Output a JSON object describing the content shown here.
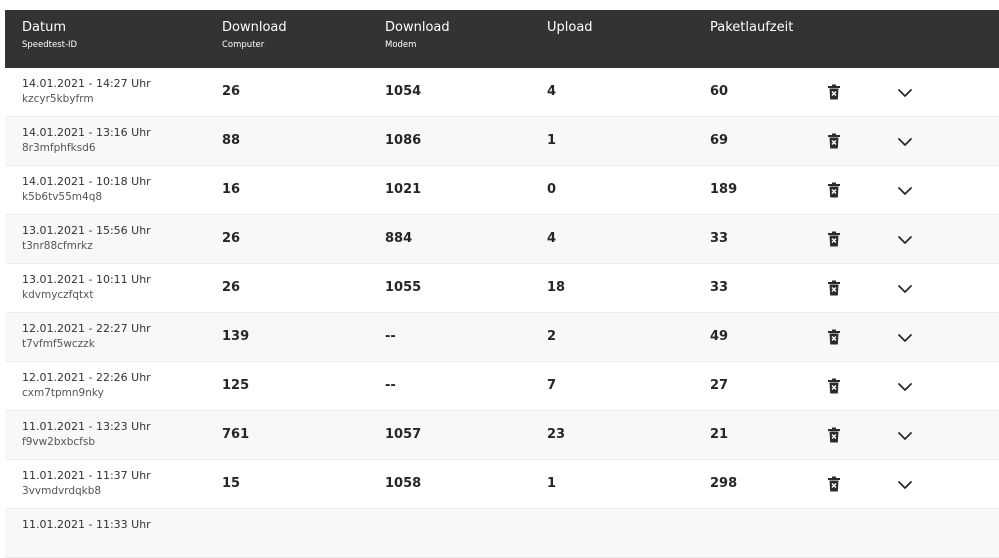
{
  "header": {
    "col_datum": "Datum",
    "col_datum_sub": "Speedtest-ID",
    "col_dl_computer": "Download",
    "col_dl_computer_sub": "Computer",
    "col_dl_modem": "Download",
    "col_dl_modem_sub": "Modem",
    "col_upload": "Upload",
    "col_ping": "Paketlaufzeit"
  },
  "rows": [
    {
      "date": "14.01.2021 - 14:27 Uhr",
      "id": "kzcyr5kbyfrm",
      "dl_computer": "26",
      "dl_modem": "1054",
      "upload": "4",
      "ping": "60"
    },
    {
      "date": "14.01.2021 - 13:16 Uhr",
      "id": "8r3mfphfksd6",
      "dl_computer": "88",
      "dl_modem": "1086",
      "upload": "1",
      "ping": "69"
    },
    {
      "date": "14.01.2021 - 10:18 Uhr",
      "id": "k5b6tv55m4q8",
      "dl_computer": "16",
      "dl_modem": "1021",
      "upload": "0",
      "ping": "189"
    },
    {
      "date": "13.01.2021 - 15:56 Uhr",
      "id": "t3nr88cfmrkz",
      "dl_computer": "26",
      "dl_modem": "884",
      "upload": "4",
      "ping": "33"
    },
    {
      "date": "13.01.2021 - 10:11 Uhr",
      "id": "kdvmyczfqtxt",
      "dl_computer": "26",
      "dl_modem": "1055",
      "upload": "18",
      "ping": "33"
    },
    {
      "date": "12.01.2021 - 22:27 Uhr",
      "id": "t7vfmf5wczzk",
      "dl_computer": "139",
      "dl_modem": "--",
      "upload": "2",
      "ping": "49"
    },
    {
      "date": "12.01.2021 - 22:26 Uhr",
      "id": "cxm7tpmn9nky",
      "dl_computer": "125",
      "dl_modem": "--",
      "upload": "7",
      "ping": "27"
    },
    {
      "date": "11.01.2021 - 13:23 Uhr",
      "id": "f9vw2bxbcfsb",
      "dl_computer": "761",
      "dl_modem": "1057",
      "upload": "23",
      "ping": "21"
    },
    {
      "date": "11.01.2021 - 11:37 Uhr",
      "id": "3vvmdvrdqkb8",
      "dl_computer": "15",
      "dl_modem": "1058",
      "upload": "1",
      "ping": "298"
    },
    {
      "date": "11.01.2021 - 11:33 Uhr",
      "id": "",
      "dl_computer": "",
      "dl_modem": "",
      "upload": "",
      "ping": ""
    }
  ],
  "icons": {
    "delete": "trash-icon",
    "expand": "chevron-down-icon"
  },
  "colors": {
    "header_bg": "#333333",
    "row_alt_bg": "#f7f8fa"
  }
}
